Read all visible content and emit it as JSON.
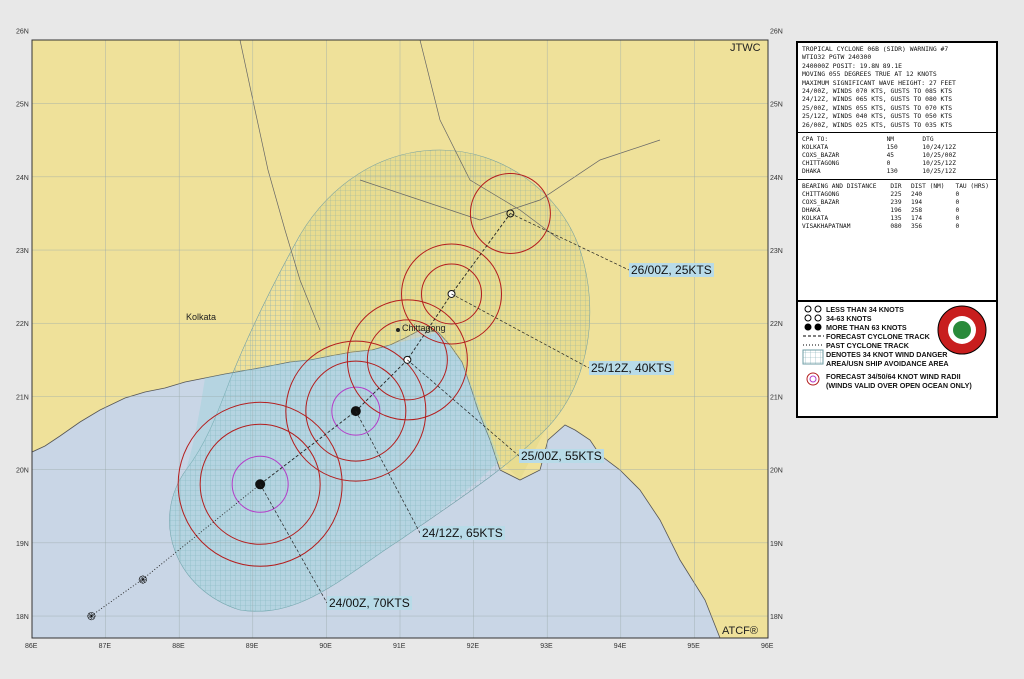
{
  "map": {
    "agency": "JTWC",
    "product": "ATCF®",
    "city_label": "Kolkata",
    "city_label_2": "Chittagong",
    "lat_labels": [
      "26N",
      "25N",
      "24N",
      "23N",
      "22N",
      "21N",
      "20N",
      "19N",
      "18N"
    ],
    "lon_labels": [
      "86E",
      "87E",
      "88E",
      "89E",
      "90E",
      "91E",
      "92E",
      "93E",
      "94E",
      "95E",
      "96E"
    ],
    "colors": {
      "land": "#efe19a",
      "water": "#c9d6e6",
      "danger_area": "#8fd0d6",
      "wind_radii": "#b41e1e",
      "storm_radii_64": "#b43cc8",
      "track": "#222222"
    }
  },
  "forecast_points": [
    {
      "label": "24/00Z, 70KTS",
      "lat": 19.8,
      "lon": 89.1,
      "status": "more than 63 knots"
    },
    {
      "label": "24/12Z, 65KTS",
      "lat": 20.8,
      "lon": 90.4,
      "status": "more than 63 knots"
    },
    {
      "label": "25/00Z, 55KTS",
      "lat": 21.5,
      "lon": 91.1,
      "status": "34-63 knots"
    },
    {
      "label": "25/12Z, 40KTS",
      "lat": 22.4,
      "lon": 91.7,
      "status": "34-63 knots"
    },
    {
      "label": "26/00Z, 25KTS",
      "lat": 23.5,
      "lon": 92.5,
      "status": "less than 34 knots"
    }
  ],
  "past_points": [
    {
      "lat": 18.5,
      "lon": 87.5
    },
    {
      "lat": 18.0,
      "lon": 86.8
    }
  ],
  "warning": {
    "lines": [
      "TROPICAL CYCLONE 06B (SIDR) WARNING #7",
      "WTIO32 PGTW 240300",
      "240000Z POSIT: 19.8N 89.1E",
      "MOVING 055 DEGREES TRUE AT 12 KNOTS",
      "MAXIMUM SIGNIFICANT WAVE HEIGHT: 27 FEET",
      "24/00Z, WINDS 070 KTS, GUSTS TO 085 KTS",
      "24/12Z, WINDS 065 KTS, GUSTS TO 080 KTS",
      "25/00Z, WINDS 055 KTS, GUSTS TO 070 KTS",
      "25/12Z, WINDS 040 KTS, GUSTS TO 050 KTS",
      "26/00Z, WINDS 025 KTS, GUSTS TO 035 KTS"
    ],
    "cpa_header": [
      "CPA TO:",
      "NM",
      "DTG"
    ],
    "cpa_rows": [
      [
        "KOLKATA",
        "150",
        "10/24/12Z"
      ],
      [
        "COXS_BAZAR",
        "45",
        "10/25/00Z"
      ],
      [
        "CHITTAGONG",
        "0",
        "10/25/12Z"
      ],
      [
        "DHAKA",
        "130",
        "10/25/12Z"
      ]
    ],
    "bearing_header": [
      "BEARING AND DISTANCE",
      "DIR",
      "DIST (NM)",
      "TAU (HRS)"
    ],
    "bearing_rows": [
      [
        "CHITTAGONG",
        "225",
        "240",
        "0"
      ],
      [
        "COXS_BAZAR",
        "239",
        "194",
        "0"
      ],
      [
        "DHAKA",
        "196",
        "258",
        "0"
      ],
      [
        "KOLKATA",
        "135",
        "174",
        "0"
      ],
      [
        "VISAKHAPATNAM",
        "080",
        "356",
        "0"
      ]
    ]
  },
  "legend": {
    "items": [
      "LESS THAN 34 KNOTS",
      "34-63 KNOTS",
      "MORE THAN 63 KNOTS",
      "FORECAST CYCLONE TRACK",
      "PAST CYCLONE TRACK",
      "DENOTES 34 KNOT WIND DANGER AREA/USN SHIP AVOIDANCE AREA",
      "FORECAST 34/50/64 KNOT WIND RADII (WINDS VALID OVER OPEN OCEAN ONLY)"
    ]
  }
}
